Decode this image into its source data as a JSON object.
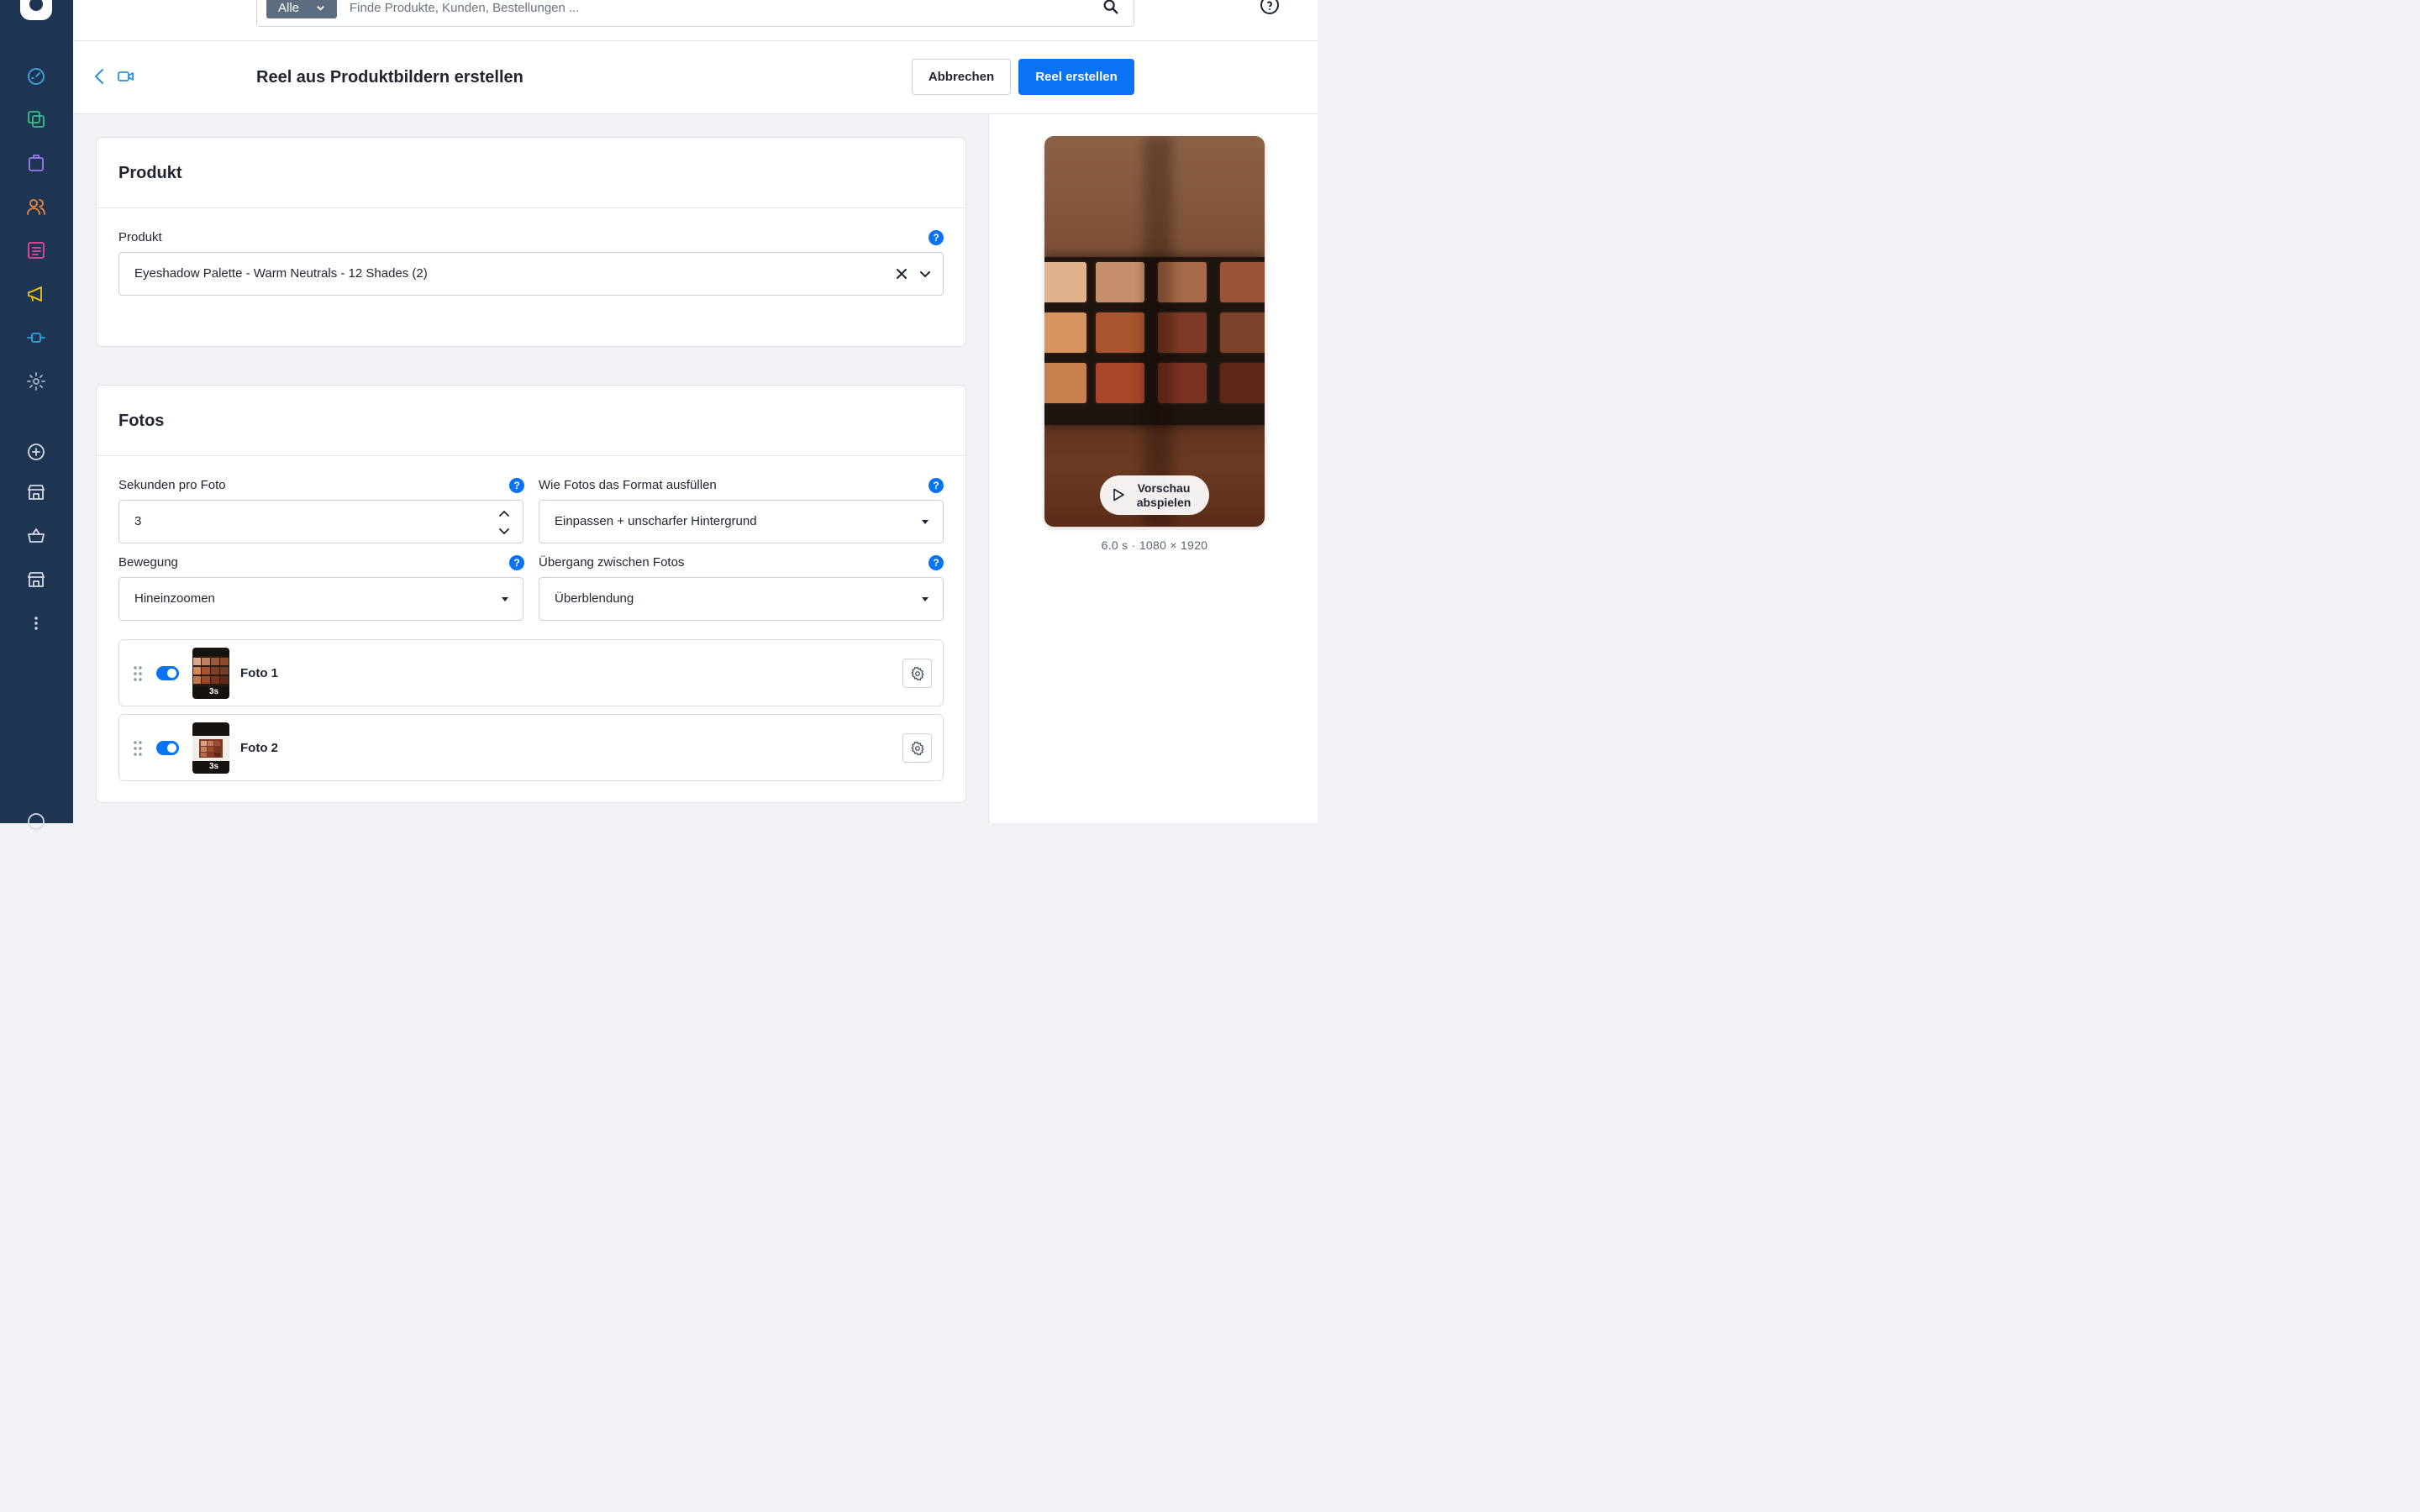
{
  "topbar": {
    "search_filter": "Alle",
    "search_placeholder": "Finde Produkte, Kunden, Bestellungen ..."
  },
  "header": {
    "title": "Reel aus Produktbildern erstellen",
    "cancel_label": "Abbrechen",
    "create_label": "Reel erstellen"
  },
  "product_card": {
    "title": "Produkt",
    "field_label": "Produkt",
    "selected": "Eyeshadow Palette - Warm Neutrals - 12 Shades (2)"
  },
  "photos_card": {
    "title": "Fotos",
    "seconds_label": "Sekunden pro Foto",
    "seconds_value": "3",
    "fill_label": "Wie Fotos das Format ausfüllen",
    "fill_value": "Einpassen + unscharfer Hintergrund",
    "motion_label": "Bewegung",
    "motion_value": "Hineinzoomen",
    "transition_label": "Übergang zwischen Fotos",
    "transition_value": "Überblendung",
    "photos": [
      {
        "name": "Foto 1",
        "duration": "3s",
        "enabled": true
      },
      {
        "name": "Foto 2",
        "duration": "3s",
        "enabled": true
      }
    ]
  },
  "preview": {
    "play_label": "Vorschau abspielen",
    "meta": "6.0 s · 1080 × 1920"
  },
  "help_glyph": "?",
  "colors": {
    "sidebar_bg": "#1f3554",
    "primary": "#0a72f5",
    "filter_bg": "#5d6d80"
  }
}
